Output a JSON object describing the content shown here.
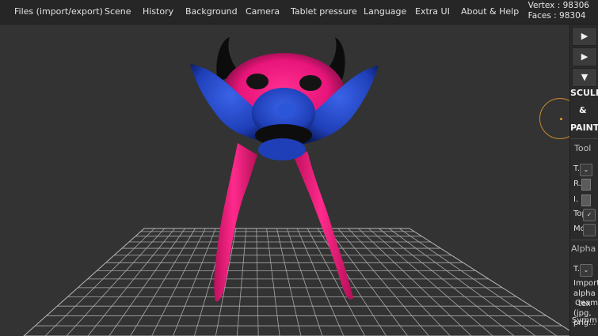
{
  "menu": [
    {
      "label": "Files (import/export)",
      "name": "menu-files"
    },
    {
      "label": "Scene",
      "name": "menu-scene"
    },
    {
      "label": "History",
      "name": "menu-history"
    },
    {
      "label": "Background",
      "name": "menu-background"
    },
    {
      "label": "Camera",
      "name": "menu-camera"
    },
    {
      "label": "Tablet pressure",
      "name": "menu-tablet-pressure"
    },
    {
      "label": "Language",
      "name": "menu-language"
    },
    {
      "label": "Extra UI",
      "name": "menu-extra-ui"
    },
    {
      "label": "About & Help",
      "name": "menu-about-help"
    }
  ],
  "stats": {
    "vertex": "Vertex : 98306",
    "faces": "Faces : 98304"
  },
  "panel": {
    "arrows": [
      "▶",
      "▶",
      "▼"
    ],
    "title_line1": "SCULP",
    "title_line2": "&",
    "title_line3": "PAINT",
    "tool_header": "Tool",
    "tool_rows": [
      "T.",
      "R.",
      "I.",
      "Topol",
      "Move"
    ],
    "alpha_header": "Alpha",
    "alpha_rows": [
      "T.",
      "Import",
      "alpha",
      "tex",
      "(jpg,",
      "png..."
    ],
    "overlay_text": [
      "Ceam",
      "Symm"
    ]
  },
  "colors": {
    "body_pink": "#e8157a",
    "body_blue": "#1f3fb8",
    "dark": "#111111",
    "background": "#333333",
    "grid": "#c0c0c0"
  }
}
